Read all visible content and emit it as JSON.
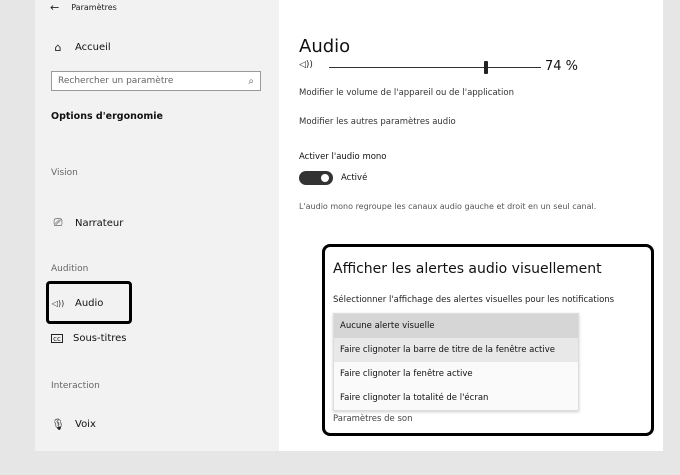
{
  "window": {
    "title": "Paramètres"
  },
  "sidebar": {
    "home_label": "Accueil",
    "search_placeholder": "Rechercher un paramètre",
    "section_title": "Options d'ergonomie",
    "groups": {
      "vision": "Vision",
      "audition": "Audition",
      "interaction": "Interaction"
    },
    "items": {
      "narrateur": "Narrateur",
      "audio": "Audio",
      "sous_titres": "Sous-titres",
      "voix": "Voix"
    }
  },
  "main": {
    "heading": "Audio",
    "volume": {
      "value": 74,
      "display": "74 %"
    },
    "volume_desc": "Modifier le volume de l'appareil ou de l'application",
    "other_audio": "Modifier les autres paramètres audio",
    "mono_label": "Activer l'audio mono",
    "mono_state": "Activé",
    "mono_desc": "L'audio mono regroupe les canaux audio gauche et droit en un seul canal.",
    "alerts": {
      "title": "Afficher les alertes audio visuellement",
      "subtitle": "Sélectionner l'affichage des alertes visuelles pour les notifications",
      "options": [
        "Aucune alerte visuelle",
        "Faire clignoter la barre de titre de la fenêtre active",
        "Faire clignoter la fenêtre active",
        "Faire clignoter la totalité de l'écran"
      ],
      "sound_settings": "Paramètres de son"
    }
  },
  "colors": {
    "sidebar_bg": "#f2f2f2",
    "toggle_on": "#333333",
    "highlight": "#000000"
  }
}
